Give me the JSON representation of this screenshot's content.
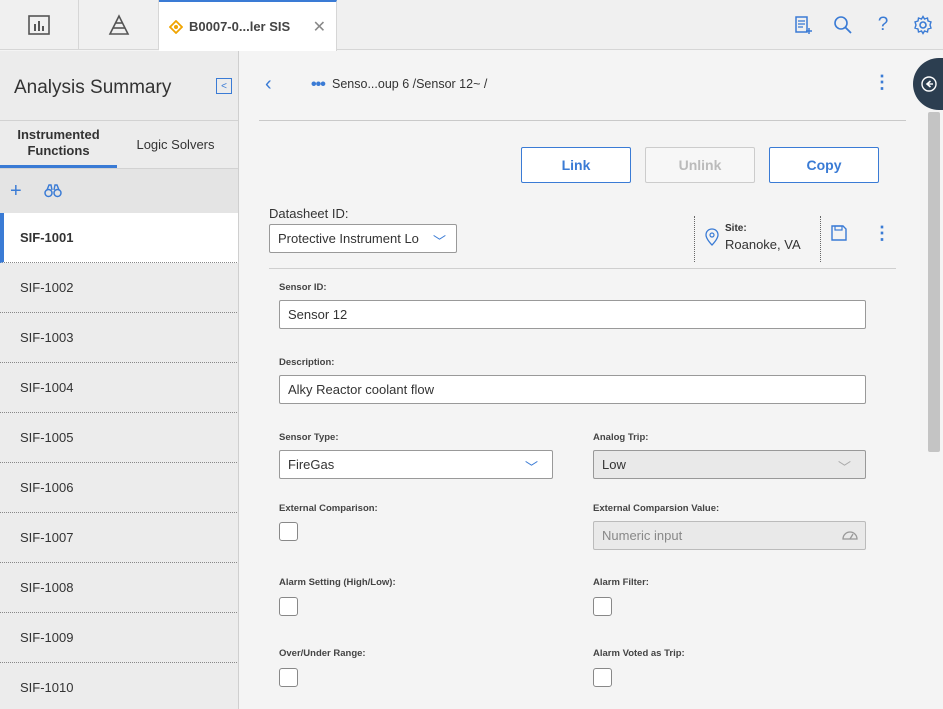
{
  "topbar": {
    "tab_title": "B0007-0...ler SIS",
    "icons": [
      "dashboard-icon",
      "hierarchy-icon",
      "asset-icon",
      "new-record-icon",
      "search-icon",
      "help-icon",
      "settings-icon"
    ]
  },
  "sidebar": {
    "title": "Analysis Summary",
    "tabs": [
      {
        "label": "Instrumented Functions"
      },
      {
        "label": "Logic Solvers"
      }
    ],
    "items": [
      {
        "label": "SIF-1001"
      },
      {
        "label": "SIF-1002"
      },
      {
        "label": "SIF-1003"
      },
      {
        "label": "SIF-1004"
      },
      {
        "label": "SIF-1005"
      },
      {
        "label": "SIF-1006"
      },
      {
        "label": "SIF-1007"
      },
      {
        "label": "SIF-1008"
      },
      {
        "label": "SIF-1009"
      },
      {
        "label": "SIF-1010"
      }
    ]
  },
  "breadcrumb": {
    "text": "Senso...oup 6 /Sensor 12~ /"
  },
  "actions": {
    "link": "Link",
    "unlink": "Unlink",
    "copy": "Copy"
  },
  "datasheet": {
    "label": "Datasheet ID:",
    "value": "Protective Instrument Lo",
    "site_label": "Site:",
    "site_value": "Roanoke, VA"
  },
  "form": {
    "sensor_id_label": "Sensor ID:",
    "sensor_id_value": "Sensor 12",
    "description_label": "Description:",
    "description_value": "Alky Reactor coolant flow",
    "sensor_type_label": "Sensor Type:",
    "sensor_type_value": "FireGas",
    "analog_trip_label": "Analog Trip:",
    "analog_trip_value": "Low",
    "external_comparison_label": "External Comparison:",
    "external_comparison_value_label": "External Comparsion Value:",
    "external_comparison_value_placeholder": "Numeric input",
    "alarm_setting_label": "Alarm Setting (High/Low):",
    "alarm_filter_label": "Alarm Filter:",
    "over_under_label": "Over/Under Range:",
    "alarm_voted_label": "Alarm Voted as Trip:"
  }
}
